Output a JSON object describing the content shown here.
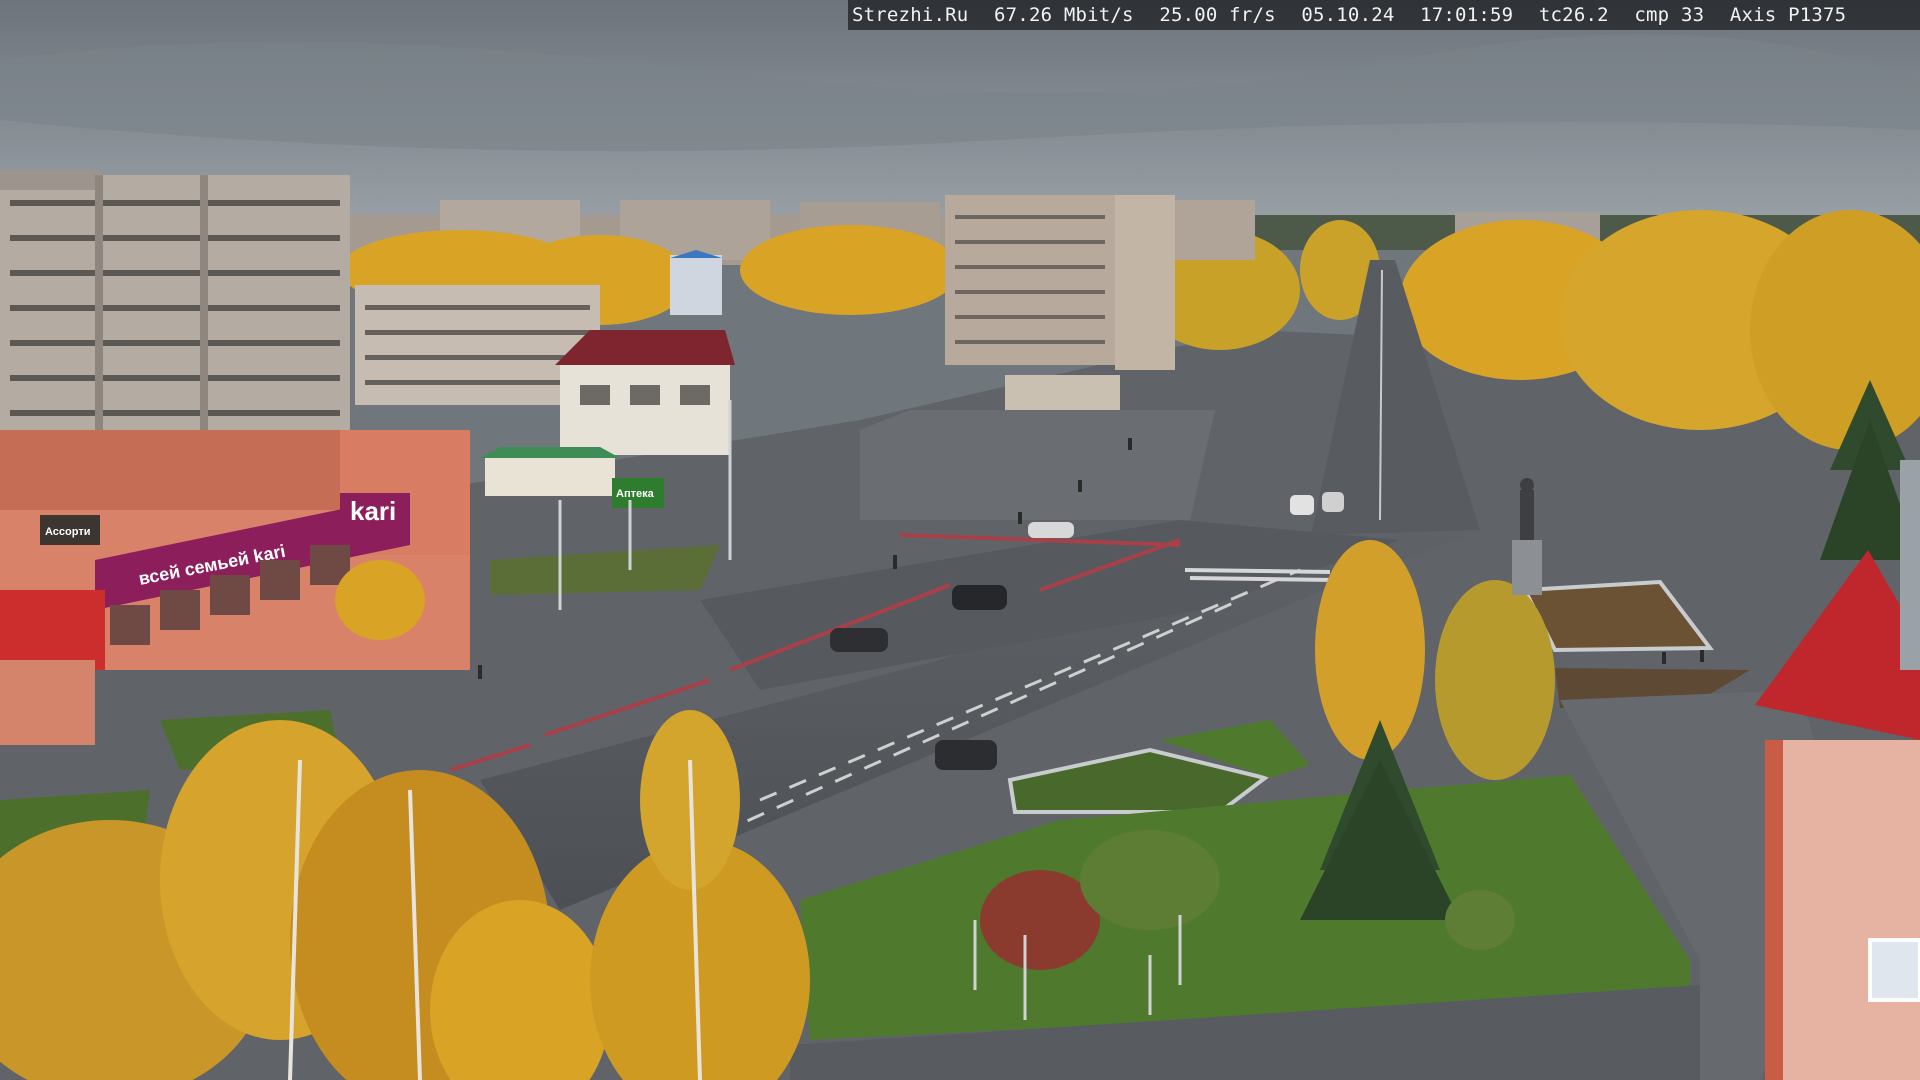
{
  "camera_overlay": {
    "site": "Strezhi.Ru",
    "bitrate": "67.26 Mbit/s",
    "framerate": "25.00 fr/s",
    "date": "05.10.24",
    "time": "17:01:59",
    "tc": "tc26.2",
    "cmp": "cmp 33",
    "model": "Axis P1375"
  },
  "signs": {
    "store_logo": "kari",
    "store_banner": "всей семьей kari",
    "shop_small": "Ассорти",
    "shop_green": "Аптека"
  },
  "colors": {
    "sky": "#8a9096",
    "foliage": "#d9a326",
    "asphalt": "#55595d",
    "grass": "#4f7a2e",
    "store_magenta": "#8c1e5c",
    "roof_red": "#c0272d"
  }
}
